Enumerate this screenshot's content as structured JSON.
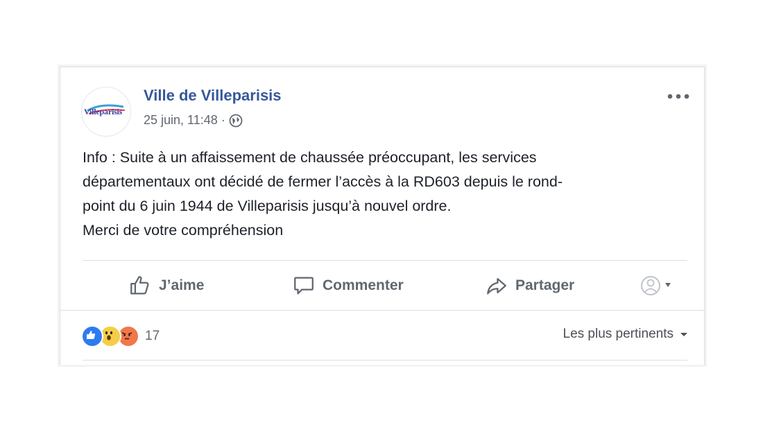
{
  "post": {
    "page_name": "Ville de Villeparisis",
    "avatar_logo_text": "Villeparisis",
    "timestamp": "25 juin, 11:48",
    "separator": "·",
    "audience_icon": "globe-icon",
    "more_icon": "more-options-icon",
    "text_lines": [
      "Info : Suite à un affaissement de chaussée préoccupant, les services",
      "départementaux ont décidé de fermer l’accès à la RD603 depuis le rond-",
      "point du 6 juin 1944 de Villeparisis jusqu’à nouvel ordre.",
      "Merci de votre compréhension"
    ]
  },
  "actions": {
    "like_label": "J’aime",
    "comment_label": "Commenter",
    "share_label": "Partager",
    "like_icon": "thumbs-up-icon",
    "comment_icon": "comment-bubble-icon",
    "share_icon": "share-arrow-icon",
    "audience_selector_icon": "profile-selector-icon"
  },
  "reactions": {
    "types": [
      "like",
      "wow",
      "angry"
    ],
    "count": "17"
  },
  "comments": {
    "sort_label": "Les plus pertinents"
  },
  "colors": {
    "link_blue": "#365899",
    "meta_gray": "#616770",
    "text": "#1d2129",
    "divider": "#dddfe2",
    "like_blue": "#2e7bf0",
    "wow_yellow": "#f7cd47",
    "angry_orange": "#f0784a"
  }
}
